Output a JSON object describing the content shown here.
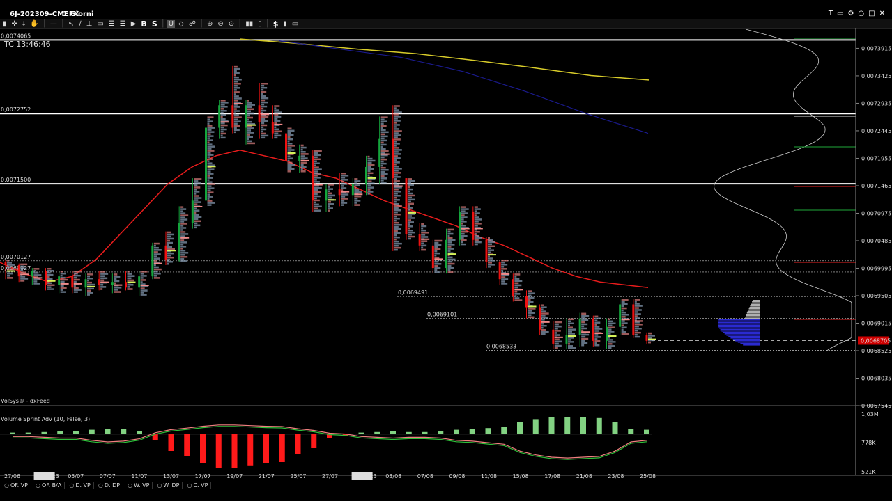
{
  "window": {
    "symbol": "6J-202309-CMEFX",
    "timeframe": "1 Giorni",
    "controls": [
      "T",
      "▭",
      "⚙",
      "○",
      "□",
      "✕"
    ]
  },
  "toolbar": {
    "buttons": [
      "▮",
      "✛",
      "⤓",
      "✋",
      "│",
      "—",
      "│",
      "↖",
      "∕",
      "⊥",
      "▭",
      "☰",
      "☰",
      "▶",
      "B",
      "S",
      "│",
      "U",
      "◇",
      "☍",
      "│",
      "⊕",
      "⊖",
      "⊙",
      "│",
      "▮▮",
      "▯",
      "│",
      "$",
      "▮",
      "▭"
    ]
  },
  "chart_meta": {
    "countdown": "TC 13:46:46",
    "vendor": "VolSys® - dxFeed",
    "indicator": "Volume Sprint Adv (10, False, 3)"
  },
  "chart_data": {
    "type": "candlestick",
    "dates": [
      "27/06",
      "07/2023",
      "05/07",
      "07/07",
      "11/07",
      "13/07",
      "17/07",
      "19/07",
      "21/07",
      "25/07",
      "27/07",
      "08/2023",
      "03/08",
      "07/08",
      "09/08",
      "11/08",
      "15/08",
      "17/08",
      "21/08",
      "23/08",
      "25/08"
    ],
    "price_axis": [
      "0,0073915",
      "0,0073425",
      "0,0072935",
      "0,0072445",
      "0,0071955",
      "0,0071465",
      "0,0070975",
      "0,0070485",
      "0,0069995",
      "0,0069505",
      "0,0069015",
      "0,0068525",
      "0,0068035",
      "0,0067545"
    ],
    "last_price": "0,0068705",
    "horizontal_levels": [
      "0,0074065",
      "0,0072752",
      "0,0071500",
      "0,0070127",
      "0,0069927",
      "0,0069491",
      "0,0069101",
      "0,0068533"
    ],
    "candles": [
      [
        0.00701,
        0.007015,
        0.00698,
        0.007005
      ],
      [
        0.007005,
        0.007008,
        0.006975,
        0.006985
      ],
      [
        0.006985,
        0.007,
        0.00697,
        0.006995
      ],
      [
        0.006995,
        0.007,
        0.00696,
        0.00697
      ],
      [
        0.00697,
        0.006995,
        0.006955,
        0.006985
      ],
      [
        0.006985,
        0.006995,
        0.006955,
        0.006965
      ],
      [
        0.006965,
        0.00699,
        0.00695,
        0.00698
      ],
      [
        0.00698,
        0.006995,
        0.00696,
        0.00697
      ],
      [
        0.00697,
        0.00699,
        0.006955,
        0.006975
      ],
      [
        0.006975,
        0.006995,
        0.00696,
        0.006965
      ],
      [
        0.006965,
        0.006995,
        0.00695,
        0.006985
      ],
      [
        0.006985,
        0.007045,
        0.00698,
        0.00704
      ],
      [
        0.00704,
        0.007065,
        0.007005,
        0.007015
      ],
      [
        0.007015,
        0.00711,
        0.00701,
        0.00708
      ],
      [
        0.00708,
        0.00716,
        0.00707,
        0.00712
      ],
      [
        0.00712,
        0.00727,
        0.00711,
        0.00725
      ],
      [
        0.00725,
        0.0073,
        0.00723,
        0.00729
      ],
      [
        0.00729,
        0.00736,
        0.00724,
        0.00725
      ],
      [
        0.00725,
        0.0073,
        0.00722,
        0.00729
      ],
      [
        0.00729,
        0.00733,
        0.00723,
        0.00726
      ],
      [
        0.00726,
        0.00729,
        0.00723,
        0.00724
      ],
      [
        0.00724,
        0.00725,
        0.00717,
        0.00719
      ],
      [
        0.00719,
        0.00722,
        0.00717,
        0.0072
      ],
      [
        0.0072,
        0.00721,
        0.0071,
        0.00712
      ],
      [
        0.00712,
        0.00715,
        0.0071,
        0.00714
      ],
      [
        0.00714,
        0.00717,
        0.00711,
        0.00713
      ],
      [
        0.00713,
        0.00716,
        0.00711,
        0.00715
      ],
      [
        0.00715,
        0.0072,
        0.00713,
        0.00718
      ],
      [
        0.00718,
        0.00727,
        0.00715,
        0.00723
      ],
      [
        0.00723,
        0.00729,
        0.00703,
        0.00716
      ],
      [
        0.00716,
        0.00716,
        0.00705,
        0.00706
      ],
      [
        0.00706,
        0.00708,
        0.00703,
        0.00704
      ],
      [
        0.00704,
        0.00705,
        0.00699,
        0.007
      ],
      [
        0.007,
        0.00707,
        0.00699,
        0.00705
      ],
      [
        0.00705,
        0.00711,
        0.00704,
        0.0071
      ],
      [
        0.0071,
        0.00711,
        0.00704,
        0.00705
      ],
      [
        0.00705,
        0.007055,
        0.007,
        0.00701
      ],
      [
        0.00701,
        0.007015,
        0.00697,
        0.00698
      ],
      [
        0.00698,
        0.00699,
        0.00694,
        0.00695
      ],
      [
        0.00695,
        0.00696,
        0.00691,
        0.00693
      ],
      [
        0.00693,
        0.006935,
        0.00688,
        0.00689
      ],
      [
        0.00689,
        0.006905,
        0.006855,
        0.006865
      ],
      [
        0.006865,
        0.00691,
        0.006855,
        0.00688
      ],
      [
        0.00688,
        0.00692,
        0.00686,
        0.00691
      ],
      [
        0.00691,
        0.006915,
        0.00686,
        0.00687
      ],
      [
        0.00687,
        0.00691,
        0.006855,
        0.006895
      ],
      [
        0.006895,
        0.006945,
        0.00688,
        0.006935
      ],
      [
        0.006935,
        0.006945,
        0.006875,
        0.00688
      ],
      [
        0.00688,
        0.006885,
        0.006865,
        0.00687
      ]
    ],
    "moving_averages": {
      "red": [
        0.00701,
        0.00699,
        0.006975,
        0.006985,
        0.007015,
        0.00706,
        0.007105,
        0.00715,
        0.00718,
        0.0072,
        0.00721,
        0.0072,
        0.00719,
        0.00717,
        0.00716,
        0.00714,
        0.00712,
        0.007105,
        0.00709,
        0.007075,
        0.007055,
        0.00704,
        0.00702,
        0.007,
        0.006985,
        0.006975,
        0.00697,
        0.006965
      ],
      "yellow": [
        0.007408,
        0.0074,
        0.00739,
        0.007382,
        0.00737,
        0.007357,
        0.007343,
        0.007335
      ],
      "blue": [
        0.007405,
        0.00739,
        0.007375,
        0.00735,
        0.007315,
        0.007275,
        0.00724
      ]
    },
    "indicator_axis": [
      "1,03M",
      "778K",
      "521K"
    ],
    "indicator_bars": [
      0.03,
      0.03,
      0.04,
      0.05,
      0.05,
      0.08,
      0.1,
      0.09,
      0.06,
      -0.1,
      -0.3,
      -0.4,
      -0.52,
      -0.6,
      -0.6,
      -0.56,
      -0.52,
      -0.5,
      -0.36,
      -0.25,
      -0.07,
      -0.02,
      0.03,
      0.04,
      0.05,
      0.04,
      0.04,
      0.05,
      0.08,
      0.09,
      0.11,
      0.13,
      0.22,
      0.27,
      0.3,
      0.31,
      0.3,
      0.29,
      0.22,
      0.1,
      0.08
    ]
  },
  "bottom_tabs": [
    "OF. VP",
    "OF. B/A",
    "D. VP",
    "D. DP",
    "W. VP",
    "W. DP",
    "C. VP"
  ],
  "colors": {
    "bull": "#14a53c",
    "bear": "#ee1111",
    "level": "#ffffff",
    "ma_red": "#e81c1c",
    "ma_yellow": "#d8cc2a",
    "ma_blue": "#1a1a8c",
    "indicator_bull": "#82d282",
    "indicator_bear": "#ff1a1a",
    "price_tag": "#d00000"
  }
}
